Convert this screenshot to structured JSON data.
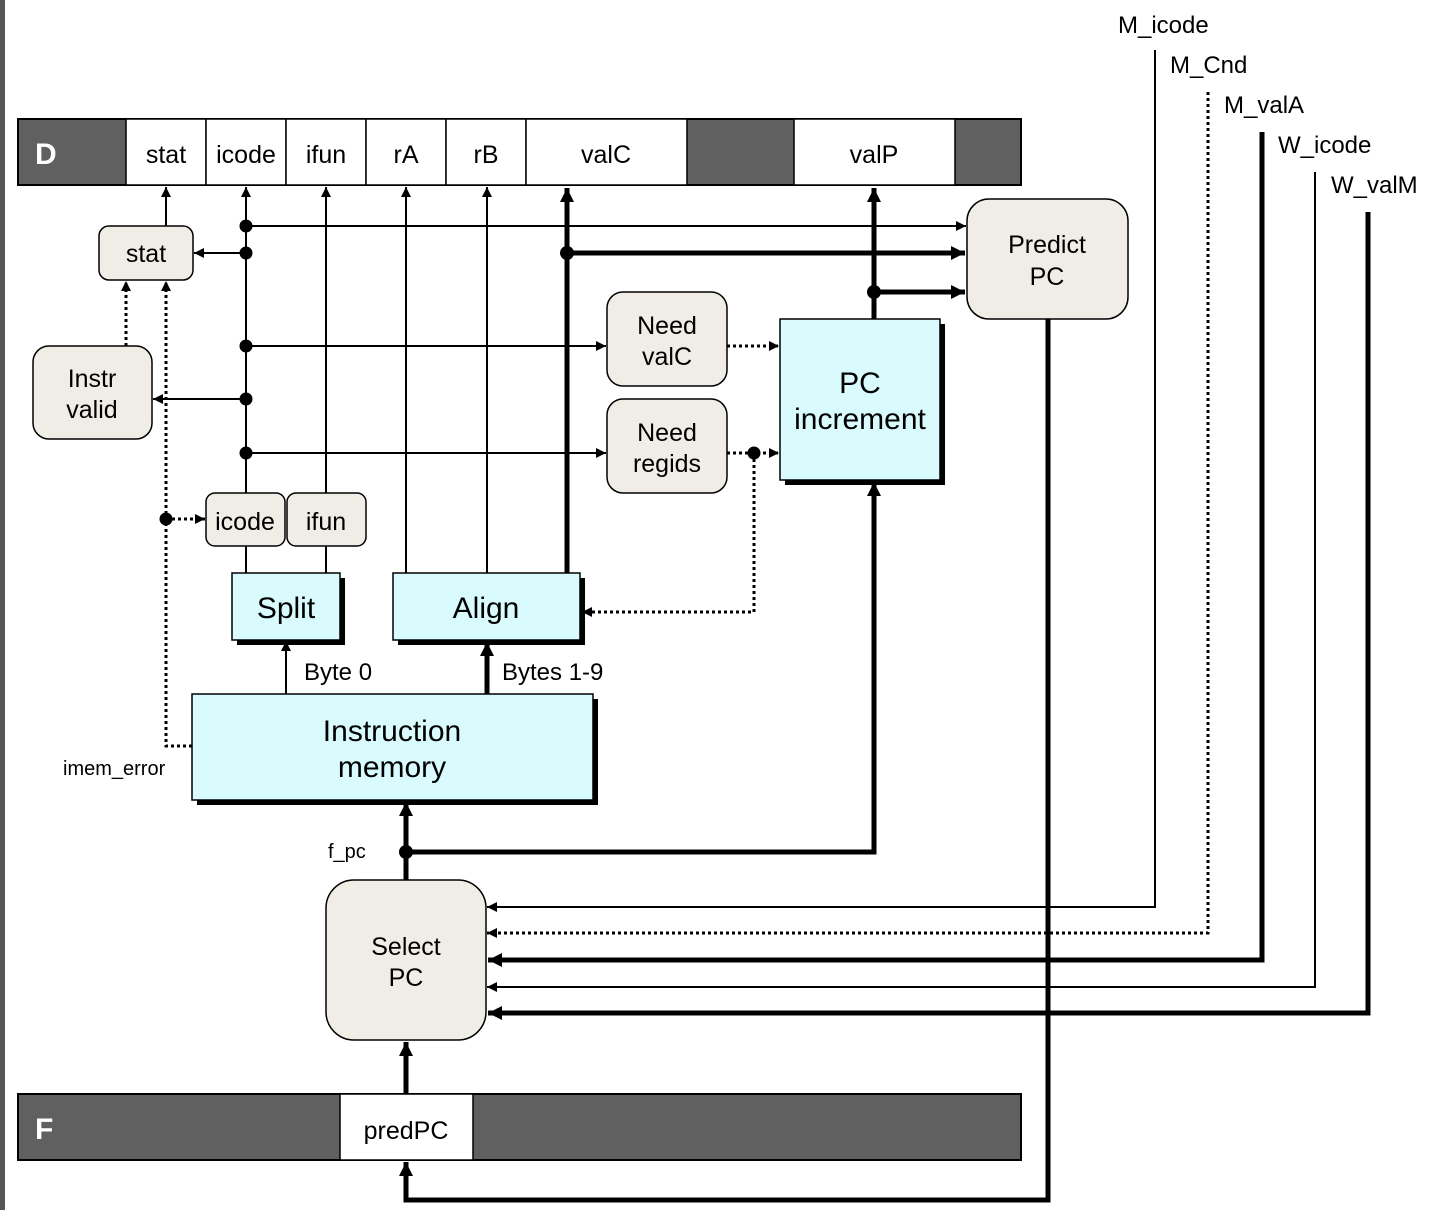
{
  "decode_register": {
    "name": "D",
    "fields": [
      "stat",
      "icode",
      "ifun",
      "rA",
      "rB",
      "valC",
      "valP"
    ]
  },
  "fetch_register": {
    "name": "F",
    "fields": [
      "predPC"
    ]
  },
  "blocks": {
    "stat": "stat",
    "instr_valid": [
      "Instr",
      "valid"
    ],
    "need_valc": [
      "Need",
      "valC"
    ],
    "need_regids": [
      "Need",
      "regids"
    ],
    "predict_pc": [
      "Predict",
      "PC"
    ],
    "pc_increment": [
      "PC",
      "increment"
    ],
    "icode": "icode",
    "ifun": "ifun",
    "split": "Split",
    "align": "Align",
    "instruction_memory": [
      "Instruction",
      "memory"
    ],
    "select_pc": [
      "Select",
      "PC"
    ]
  },
  "signals": {
    "byte0": "Byte 0",
    "bytes19": "Bytes 1-9",
    "imem_error": "imem_error",
    "f_pc": "f_pc",
    "m_icode": "M_icode",
    "m_cnd": "M_Cnd",
    "m_vala": "M_valA",
    "w_icode": "W_icode",
    "w_valm": "W_valM"
  },
  "colors": {
    "register_bar": "#606060",
    "control_block": "#f0ede6",
    "hardware_block": "#d9fbfd"
  }
}
